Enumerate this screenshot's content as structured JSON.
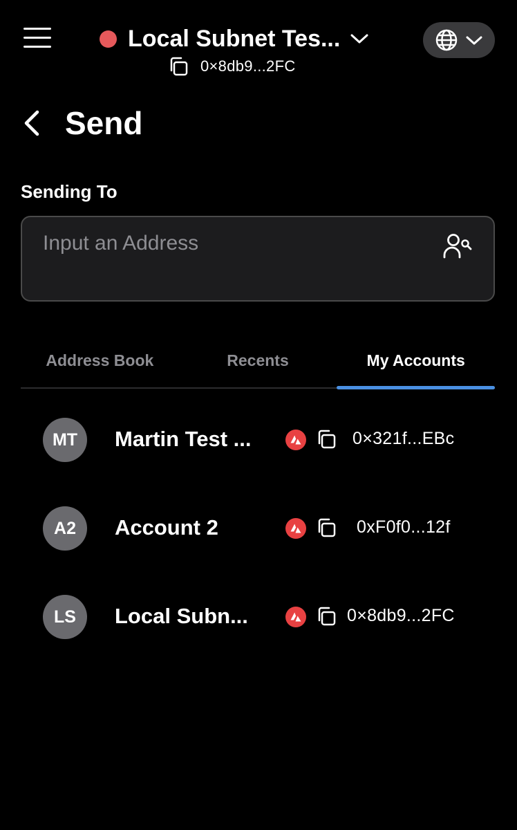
{
  "header": {
    "network_name": "Local Subnet Tes...",
    "active_address": "0×8db9...2FC",
    "status_color": "#e5595b",
    "icons": [
      "menu-icon",
      "chevron-down-icon",
      "copy-icon",
      "globe-icon"
    ]
  },
  "page": {
    "title": "Send",
    "sending_to_label": "Sending To",
    "address_placeholder": "Input an Address"
  },
  "tabs": [
    {
      "label": "Address Book",
      "active": false
    },
    {
      "label": "Recents",
      "active": false
    },
    {
      "label": "My Accounts",
      "active": true
    }
  ],
  "accounts": [
    {
      "initials": "MT",
      "name": "Martin Test ...",
      "address": "0×321f...EBc"
    },
    {
      "initials": "A2",
      "name": "Account 2",
      "address": "0xF0f0...12f"
    },
    {
      "initials": "LS",
      "name": "Local Subn...",
      "address": "0×8db9...2FC"
    }
  ],
  "colors": {
    "background": "#000000",
    "accent": "#4a90e2",
    "avax_red": "#e84142",
    "avatar_bg": "#6a6a6e"
  }
}
